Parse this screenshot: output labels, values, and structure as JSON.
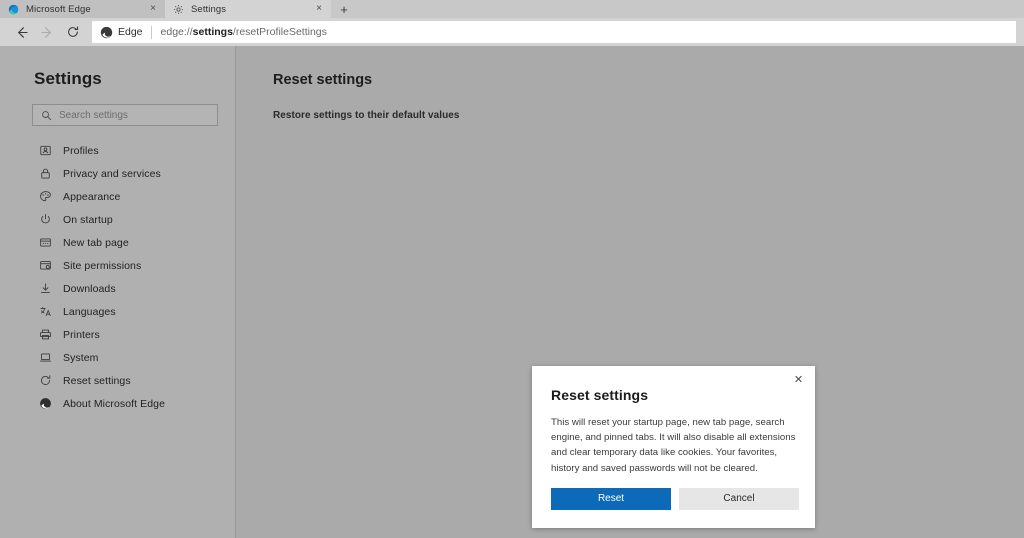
{
  "browser": {
    "tabs": [
      {
        "title": "Microsoft Edge",
        "favicon": "edge-logo-icon",
        "active": false,
        "close_label": "×"
      },
      {
        "title": "Settings",
        "favicon": "gear-icon",
        "active": true,
        "close_label": "×"
      }
    ],
    "new_tab_label": "+",
    "toolbar": {
      "back_label": "←",
      "forward_label": "→",
      "refresh_label": "↻",
      "omnibox": {
        "brand": "Edge",
        "url_prefix": "edge://",
        "url_bold": "settings",
        "url_suffix": "/resetProfileSettings"
      }
    }
  },
  "sidebar": {
    "title": "Settings",
    "search": {
      "placeholder": "Search settings",
      "value": "",
      "icon": "search-icon"
    },
    "items": [
      {
        "label": "Profiles",
        "icon": "profile-card-icon"
      },
      {
        "label": "Privacy and services",
        "icon": "lock-icon"
      },
      {
        "label": "Appearance",
        "icon": "palette-icon"
      },
      {
        "label": "On startup",
        "icon": "power-icon"
      },
      {
        "label": "New tab page",
        "icon": "new-tab-page-icon"
      },
      {
        "label": "Site permissions",
        "icon": "site-permissions-icon"
      },
      {
        "label": "Downloads",
        "icon": "download-arrow-icon"
      },
      {
        "label": "Languages",
        "icon": "languages-icon"
      },
      {
        "label": "Printers",
        "icon": "printer-icon"
      },
      {
        "label": "System",
        "icon": "laptop-icon"
      },
      {
        "label": "Reset settings",
        "icon": "reset-circular-arrow-icon"
      },
      {
        "label": "About Microsoft Edge",
        "icon": "edge-logo-icon"
      }
    ]
  },
  "main": {
    "title": "Reset settings",
    "section_heading": "Restore settings to their default values"
  },
  "dialog": {
    "title": "Reset settings",
    "body": "This will reset your startup page, new tab page, search engine, and pinned tabs. It will also disable all extensions and clear temporary data like cookies. Your favorites, history and saved passwords will not be cleared.",
    "close_label": "✕",
    "primary_button": "Reset",
    "secondary_button": "Cancel"
  },
  "colors": {
    "accent": "#0c6ab8",
    "tabstrip_bg": "#c8c8c8",
    "toolbar_bg": "#d3d3d3",
    "sidebar_bg": "#b0b0b0",
    "content_bg": "#aaaaaa",
    "dialog_bg": "#ffffff"
  }
}
